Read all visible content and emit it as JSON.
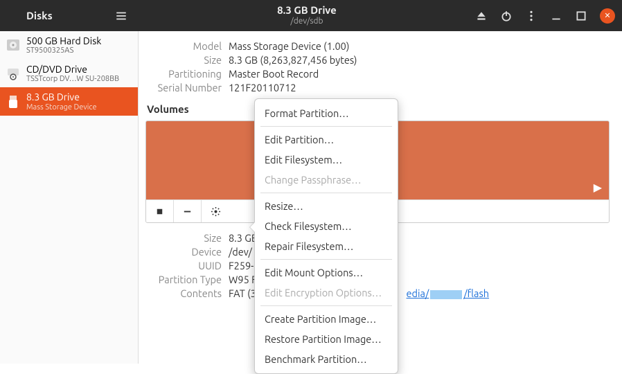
{
  "titlebar": {
    "app": "Disks",
    "drive_name": "8.3 GB Drive",
    "drive_path": "/dev/sdb"
  },
  "sidebar": {
    "items": [
      {
        "name": "500 GB Hard Disk",
        "sub": "ST9500325AS"
      },
      {
        "name": "CD/DVD Drive",
        "sub": "TSSTcorp DV…W SU-208BB"
      },
      {
        "name": "8.3 GB Drive",
        "sub": "Mass Storage Device"
      }
    ]
  },
  "info": {
    "model_label": "Model",
    "model": "Mass Storage Device (1.00)",
    "size_label": "Size",
    "size": "8.3 GB (8,263,827,456 bytes)",
    "partitioning_label": "Partitioning",
    "partitioning": "Master Boot Record",
    "serial_label": "Serial Number",
    "serial": "121F20110712"
  },
  "volumes_title": "Volumes",
  "details": {
    "size_label": "Size",
    "size": "8.3 GB",
    "device_label": "Device",
    "device": "/dev/",
    "uuid_label": "UUID",
    "uuid": "F259-",
    "ptype_label": "Partition Type",
    "ptype": "W95 F",
    "contents_label": "Contents",
    "contents_prefix": "FAT (3",
    "mount_prefix": "edia/",
    "mount_link": "/flash"
  },
  "menu": {
    "format": "Format Partition…",
    "edit_partition": "Edit Partition…",
    "edit_filesystem": "Edit Filesystem…",
    "change_passphrase": "Change Passphrase…",
    "resize": "Resize…",
    "check_fs": "Check Filesystem…",
    "repair_fs": "Repair Filesystem…",
    "edit_mount": "Edit Mount Options…",
    "edit_encryption": "Edit Encryption Options…",
    "create_image": "Create Partition Image…",
    "restore_image": "Restore Partition Image…",
    "benchmark": "Benchmark Partition…"
  }
}
